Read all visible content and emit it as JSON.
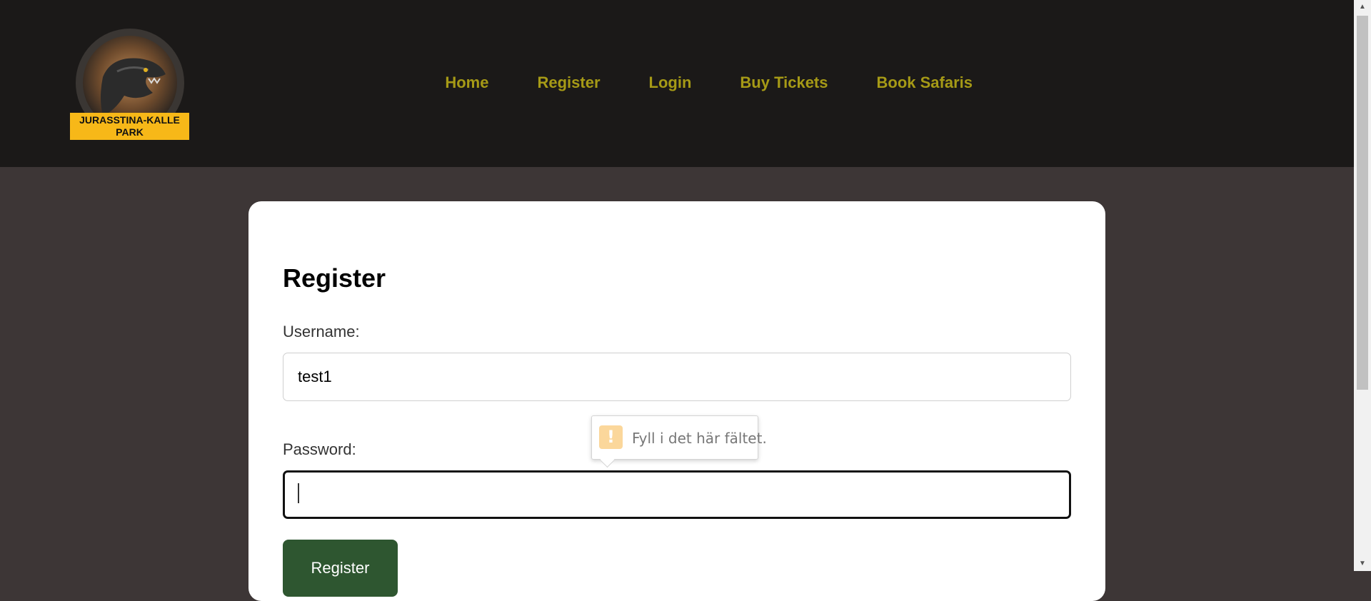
{
  "header": {
    "logo": {
      "line1": "JURASSTINA-KALLE",
      "line2": "PARK"
    },
    "nav": [
      {
        "label": "Home"
      },
      {
        "label": "Register"
      },
      {
        "label": "Login"
      },
      {
        "label": "Buy Tickets"
      },
      {
        "label": "Book Safaris"
      }
    ]
  },
  "form": {
    "title": "Register",
    "username": {
      "label": "Username:",
      "value": "test1"
    },
    "password": {
      "label": "Password:",
      "value": ""
    },
    "submit_label": "Register"
  },
  "validation_tooltip": {
    "icon": "!",
    "message": "Fyll i det här fältet."
  },
  "colors": {
    "header_bg": "#1b1918",
    "page_bg": "#3d3636",
    "nav_link": "#a69a16",
    "logo_banner": "#f7b818",
    "submit_bg": "#2e5630"
  }
}
